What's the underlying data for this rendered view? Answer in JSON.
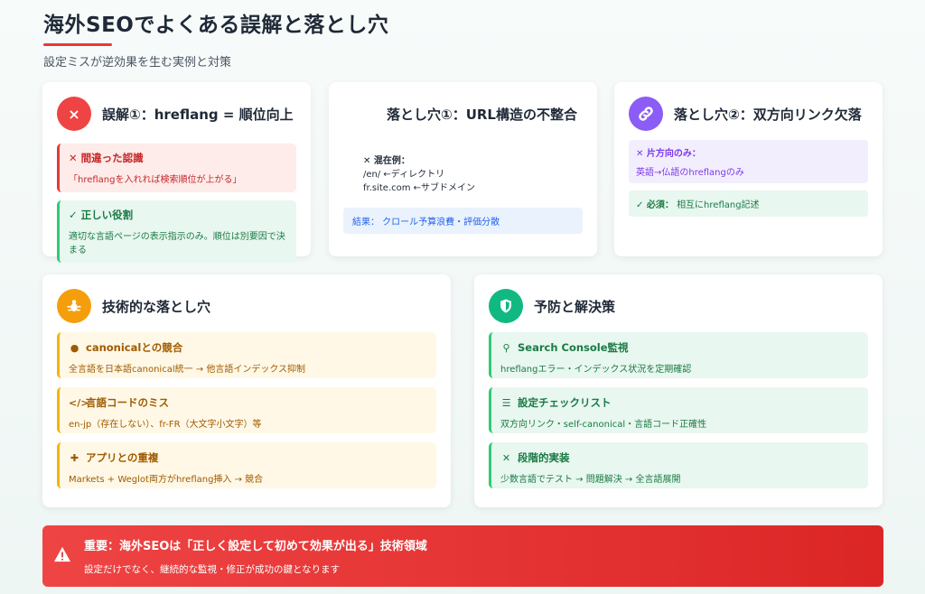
{
  "header": {
    "title": "海外SEOでよくある誤解と落とし穴",
    "subtitle": "設定ミスが逆効果を生む実例と対策",
    "accent": "#e53935"
  },
  "card1": {
    "icon": "×",
    "title": "誤解①：hreflang = 順位向上",
    "wrong_title": "✕ 間違った認識",
    "wrong_text": "「hreflangを入れれば検索順位が上がる」",
    "right_title": "✓ 正しい役割",
    "right_text": "適切な言語ページの表示指示のみ。順位は別要因で決まる"
  },
  "card2": {
    "title": "落とし穴①：URL構造の不整合",
    "mix_title": "✕ 混在例：",
    "mix_line1": "/en/ ←ディレクトリ",
    "mix_line2": "fr.site.com ←サブドメイン",
    "result": "結果： クロール予算浪費・評価分散"
  },
  "card3": {
    "title": "落とし穴②：双方向リンク欠落",
    "oneway_title": "✕ 片方向のみ：",
    "oneway_text": "英語→仏語のhreflangのみ",
    "must_label": "✓ 必須：",
    "must_text": "相互にhreflang記述"
  },
  "card4": {
    "title": "技術的な落とし穴",
    "items": [
      {
        "title": "canonicalとの競合",
        "text": "全言語を日本語canonical統一 → 他言語インデックス抑制"
      },
      {
        "title": "言語コードのミス",
        "text": "en-jp（存在しない）、fr-FR（大文字小文字）等"
      },
      {
        "title": "アプリとの重複",
        "text": "Markets + Weglot両方がhreflang挿入 → 競合"
      }
    ]
  },
  "card5": {
    "title": "予防と解決策",
    "items": [
      {
        "title": "Search Console監視",
        "text": "hreflangエラー・インデックス状況を定期確認"
      },
      {
        "title": "設定チェックリスト",
        "text": "双方向リンク・self-canonical・言語コード正確性"
      },
      {
        "title": "段階的実装",
        "text": "少数言語でテスト → 問題解決 → 全言語展開"
      }
    ]
  },
  "banner": {
    "title": "重要：海外SEOは「正しく設定して初めて効果が出る」技術領域",
    "text": "設定だけでなく、継続的な監視・修正が成功の鍵となります"
  },
  "colors": {
    "red": "#e53935",
    "purple": "#8b5cf6",
    "amber": "#f59e0b",
    "green": "#10b981"
  }
}
